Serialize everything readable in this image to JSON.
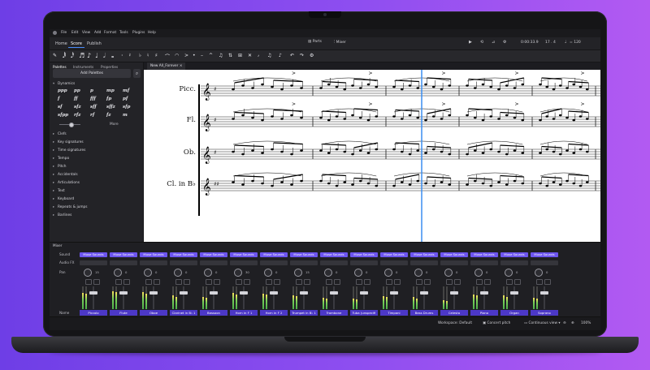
{
  "app": {
    "menu": [
      "File",
      "Edit",
      "View",
      "Add",
      "Format",
      "Tools",
      "Plugins",
      "Help"
    ],
    "tabs": [
      {
        "label": "Home",
        "active": false
      },
      {
        "label": "Score",
        "active": true
      },
      {
        "label": "Publish",
        "active": false
      }
    ],
    "center_buttons": {
      "parts": "Parts",
      "mixer": "Mixer"
    },
    "transport": {
      "time": "0:00:33.9",
      "position": "17 . 4",
      "tempo_symbol": "♩",
      "tempo": "= 120"
    },
    "accent": "#4a8bfa"
  },
  "sidebar": {
    "tabs": [
      {
        "label": "Palettes",
        "active": true
      },
      {
        "label": "Instruments",
        "active": false
      },
      {
        "label": "Properties",
        "active": false
      }
    ],
    "add_palettes": "Add Palettes",
    "search_icon": "search-icon",
    "open_palette": "Dynamics",
    "dynamics": [
      "ppp",
      "pp",
      "p",
      "mp",
      "mf",
      "f",
      "ff",
      "fff",
      "fp",
      "pf",
      "sf",
      "sfz",
      "sff",
      "sffz",
      "sfp",
      "sfpp",
      "rfz",
      "rf",
      "fz",
      "m"
    ],
    "more": "More",
    "palettes": [
      "Clefs",
      "Key signatures",
      "Time signatures",
      "Tempo",
      "Pitch",
      "Accidentals",
      "Articulations",
      "Text",
      "Keyboard",
      "Repeats & jumps",
      "Barlines"
    ]
  },
  "score": {
    "tab": "New All_Forever",
    "tab_close": "×",
    "instruments": [
      "Picc.",
      "Fl.",
      "Ob.",
      "Cl. in B♭"
    ]
  },
  "mixer": {
    "title": "Mixer",
    "row_labels": {
      "sound": "Sound",
      "audio_fx": "Audio FX",
      "pan": "Pan",
      "name": "Name"
    },
    "sound_label": "Muse Sounds",
    "channels": [
      {
        "name": "Piccolo",
        "pan": "15",
        "level": 0.72
      },
      {
        "name": "Flute",
        "pan": "0",
        "level": 0.8
      },
      {
        "name": "Oboe",
        "pan": "0",
        "level": 0.75
      },
      {
        "name": "Clarinet in B♭ 1",
        "pan": "0",
        "level": 0.6
      },
      {
        "name": "Bassoon",
        "pan": "0",
        "level": 0.55
      },
      {
        "name": "Horn in F 1",
        "pan": "30",
        "level": 0.7
      },
      {
        "name": "Horn in F 2",
        "pan": "0",
        "level": 0.68
      },
      {
        "name": "Trumpet in B♭ 1",
        "pan": "15",
        "level": 0.62
      },
      {
        "name": "Trombone",
        "pan": "0",
        "level": 0.5
      },
      {
        "name": "Tuba (unspecifi",
        "pan": "0",
        "level": 0.45
      },
      {
        "name": "Timpani",
        "pan": "0",
        "level": 0.58
      },
      {
        "name": "Bass Drums",
        "pan": "0",
        "level": 0.52
      },
      {
        "name": "Celesta",
        "pan": "0",
        "level": 0.4
      },
      {
        "name": "Piano",
        "pan": "0",
        "level": 0.66
      },
      {
        "name": "Organ",
        "pan": "0",
        "level": 0.6
      },
      {
        "name": "Soprano",
        "pan": "0",
        "level": 0.5
      }
    ]
  },
  "status": {
    "workspace": "Workspace: Default",
    "concert_pitch": "Concert pitch",
    "view": "Continuous view",
    "zoom": "100%"
  }
}
